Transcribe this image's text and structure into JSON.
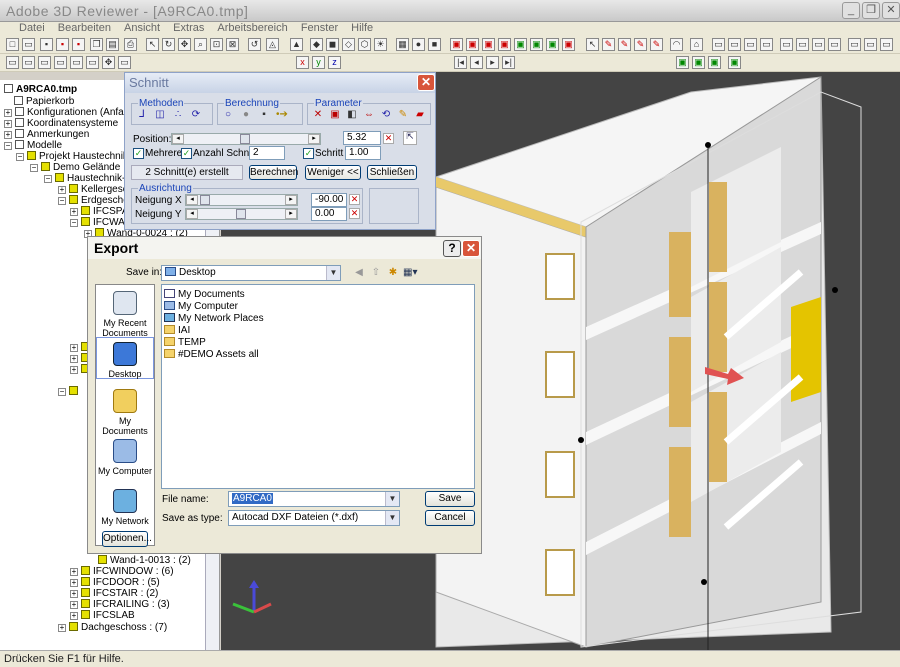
{
  "app": {
    "title": "Adobe 3D Reviewer - [A9RCA0.tmp]"
  },
  "menu": [
    "Datei",
    "Bearbeiten",
    "Ansicht",
    "Extras",
    "Arbeitsbereich",
    "Fenster",
    "Hilfe"
  ],
  "tree": {
    "root": "A9RCA0.tmp",
    "items": [
      "Papierkorb",
      "Konfigurationen (Anfangskonf",
      "Koordinatensysteme",
      "Anmerkungen",
      "Modelle",
      "Projekt Haustechnik Anw",
      "Demo Gelände",
      "Haustechnik-De",
      "Kellergeschos",
      "Erdgeschoss",
      "IFCSPAC",
      "IFCWAL",
      "Wand-0-0024 : (2)",
      "Wand-1-0013 : (2)",
      "IFCWINDOW : (6)",
      "IFCDOOR : (5)",
      "IFCSTAIR : (2)",
      "IFCRAILING : (3)",
      "IFCSLAB",
      "Dachgeschoss : (7)"
    ]
  },
  "schnitt": {
    "title": "Schnitt",
    "methoden": "Methoden",
    "berechnung": "Berechnung",
    "parameter": "Parameter",
    "position_label": "Position:",
    "position_value": "5.32",
    "mehrere": "Mehrere",
    "anzahl_label": "Anzahl Schnitte",
    "anzahl_value": "2",
    "schritt_label": "Schritt",
    "schritt_value": "1.00",
    "status": "2 Schnitt(e) erstellt",
    "berechnen": "Berechnen",
    "weniger": "Weniger <<",
    "schliessen": "Schließen",
    "ausrichtung": "Ausrichtung",
    "neigung_x_label": "Neigung X",
    "neigung_x_value": "-90.00",
    "neigung_y_label": "Neigung Y",
    "neigung_y_value": "0.00"
  },
  "export": {
    "title": "Export",
    "save_in_label": "Save in:",
    "save_in_value": "Desktop",
    "places": [
      "My Recent Documents",
      "Desktop",
      "My Documents",
      "My Computer",
      "My Network"
    ],
    "files": [
      "My Documents",
      "My Computer",
      "My Network Places",
      "IAI",
      "TEMP",
      "#DEMO Assets all"
    ],
    "file_name_label": "File name:",
    "file_name_value": "A9RCA0",
    "save_type_label": "Save as type:",
    "save_type_value": "Autocad DXF Dateien (*.dxf)",
    "save": "Save",
    "cancel": "Cancel",
    "optionen": "Optionen..."
  },
  "status": {
    "text": "Drücken Sie F1 für Hilfe."
  },
  "colors": {
    "accent": "#e4c400",
    "close": "#d8553a",
    "viewport": "#444444"
  }
}
